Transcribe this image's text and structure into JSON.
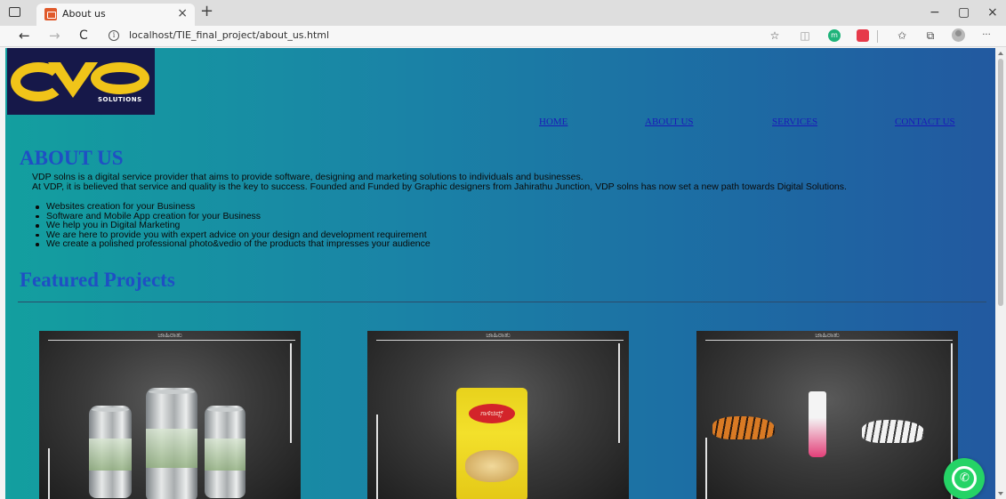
{
  "browser": {
    "tab_title": "About us",
    "tab_close": "×",
    "new_tab": "+",
    "url": "localhost/TIE_final_project/about_us.html",
    "window": {
      "minimize": "−",
      "maximize": "▢",
      "close": "×"
    },
    "nav": {
      "back": "←",
      "forward": "→",
      "refresh": "C",
      "info": "i"
    },
    "toolbar_icons": [
      "favorites-add-icon",
      "extension-icon",
      "extension-green-icon",
      "extension-red-icon",
      "favorites-icon",
      "collections-icon",
      "profile-icon",
      "more-icon"
    ],
    "more": "···"
  },
  "site": {
    "logo_text": "SOLUTIONS",
    "nav": [
      "HOME",
      "ABOUT US",
      "SERVICES",
      "CONTACT US"
    ],
    "about_title": "ABOUT US",
    "intro": [
      "VDP solns is a digital service provider that aims to provide software, designing and marketing solutions to individuals and businesses.",
      "At VDP, it is believed that service and quality is the key to success. Founded and Funded by Graphic designers from Jahirathu Junction, VDP solns has now set a new path towards Digital Solutions."
    ],
    "services": [
      "Websites creation for your Business",
      "Software and Mobile App creation for your Business",
      "We help you in Digital Marketing",
      "We are here to provide you with expert advice on your design and development requirement",
      "We create a polished professional photo&vedio of the products that impresses your audience"
    ],
    "featured_title": "Featured Projects",
    "projects": [
      {
        "label": "ಜಾಹಿರಾತು"
      },
      {
        "label": "ಜಾಹಿರಾತು",
        "product_text": "ಗಾಳಿಚಿಪ್ಸ್"
      },
      {
        "label": "ಜಾಹಿರಾತು"
      }
    ]
  },
  "colors": {
    "heading": "#1f4fc4",
    "nav_link": "#1a1ab8",
    "logo_bg": "#161849",
    "logo_gold": "#f0c419",
    "whatsapp": "#25d366"
  }
}
